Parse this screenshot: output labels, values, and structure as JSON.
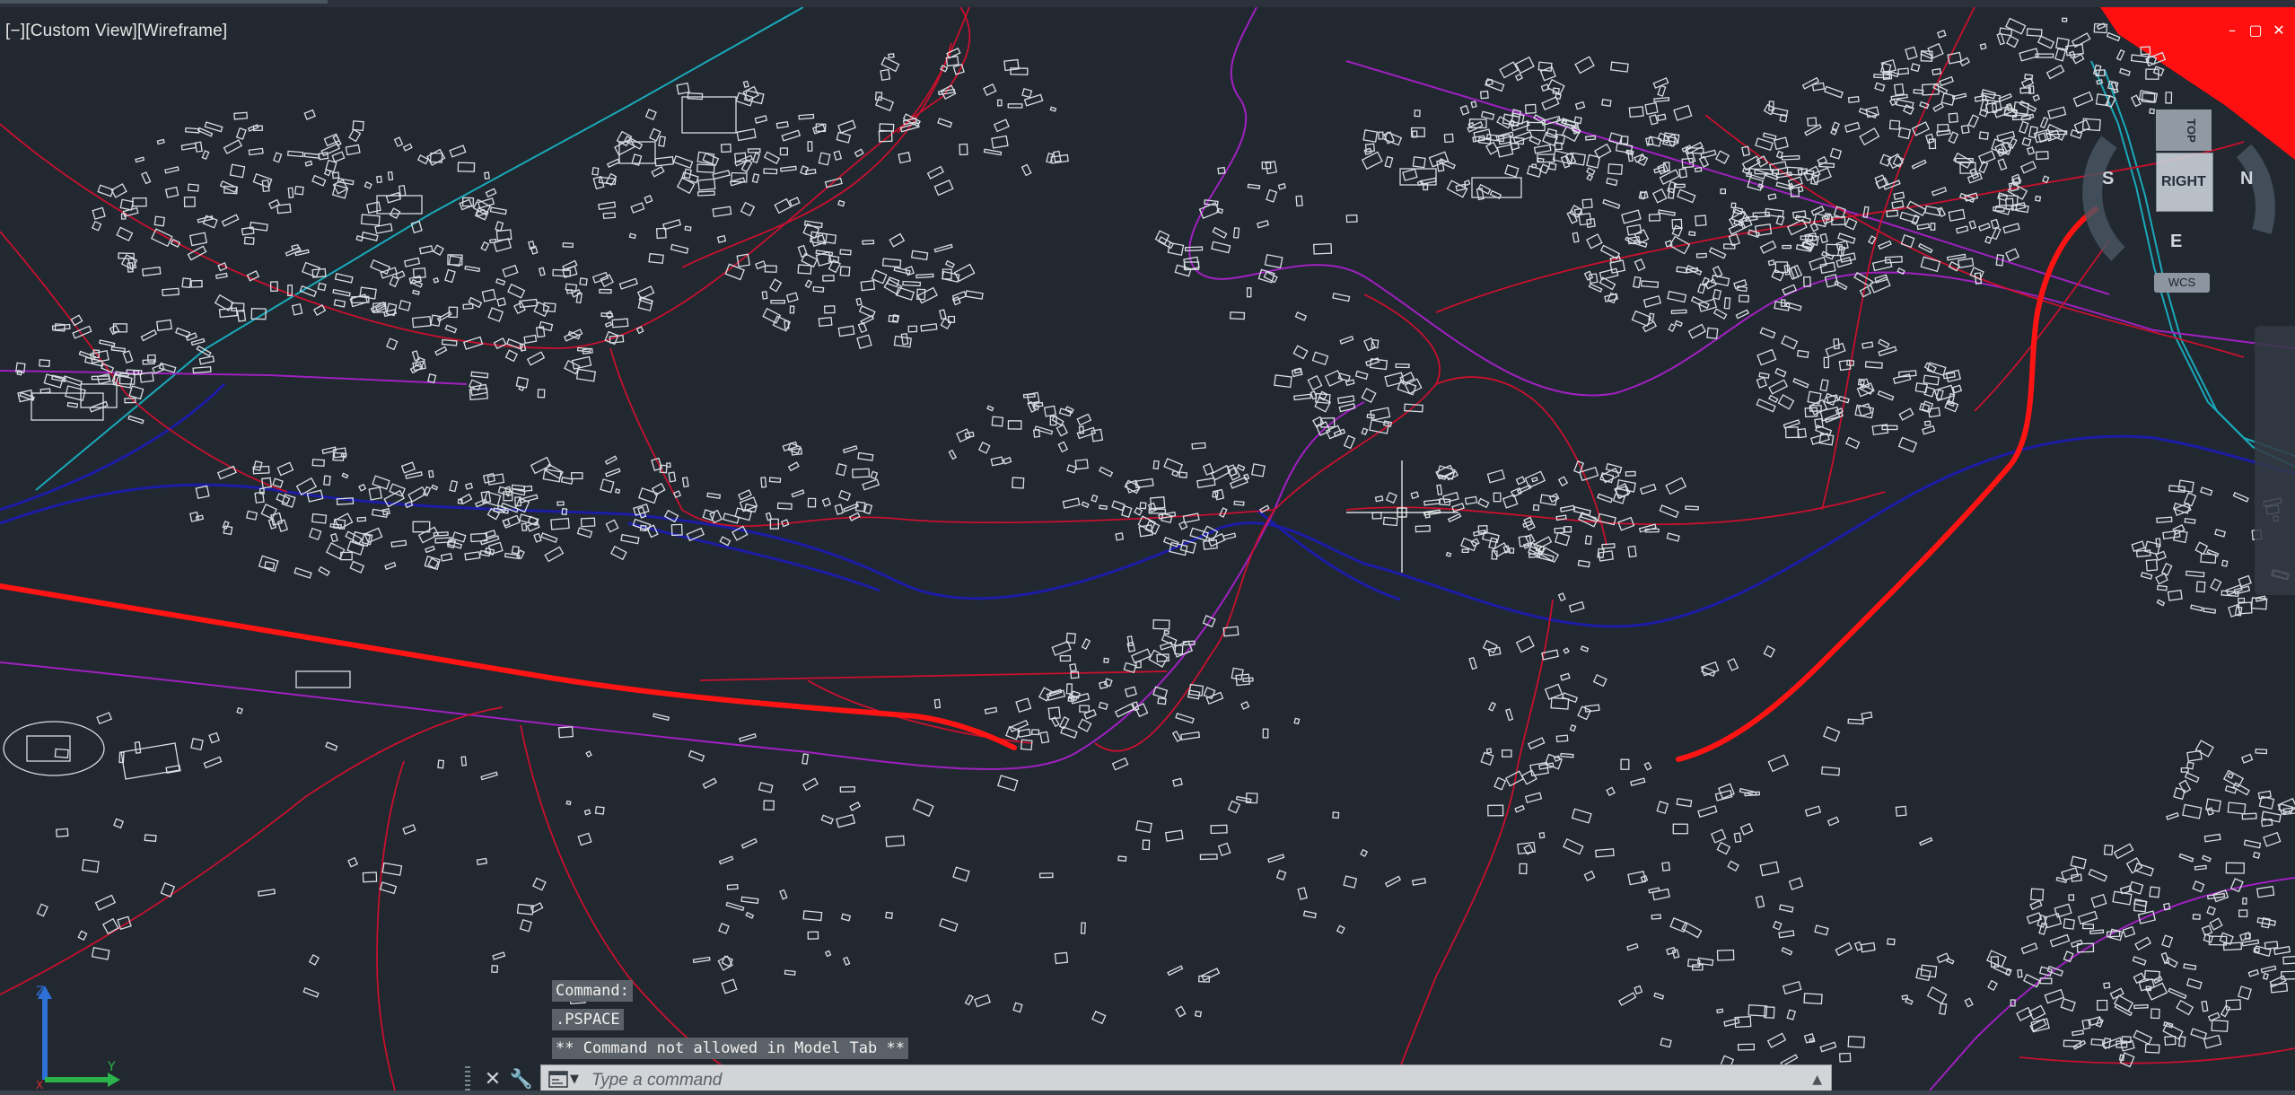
{
  "viewport": {
    "label_parts": [
      "[−]",
      "[Custom View]",
      "[Wireframe]"
    ],
    "window_controls": [
      "–",
      "▢",
      "✕"
    ]
  },
  "viewcube": {
    "face_right": "RIGHT",
    "face_top": "TOP",
    "compass": [
      "S",
      "E",
      "N"
    ],
    "wcs": "WCS"
  },
  "command_line": {
    "history": [
      "Command:",
      ".PSPACE",
      "** Command not allowed in Model Tab **"
    ],
    "placeholder": "Type a command",
    "close_icon": "✕",
    "customize_icon": "🔧"
  },
  "ucs": {
    "x_label": "X",
    "y_label": "Y",
    "z_label": "Z"
  },
  "colors": {
    "background": "#212830",
    "buildings": "#d8dde2",
    "roads": "#c8102e",
    "highway": "#ff1a1a",
    "rail": "#1a1aa0",
    "boundary": "#a020c0",
    "river": "#18a8b8"
  }
}
